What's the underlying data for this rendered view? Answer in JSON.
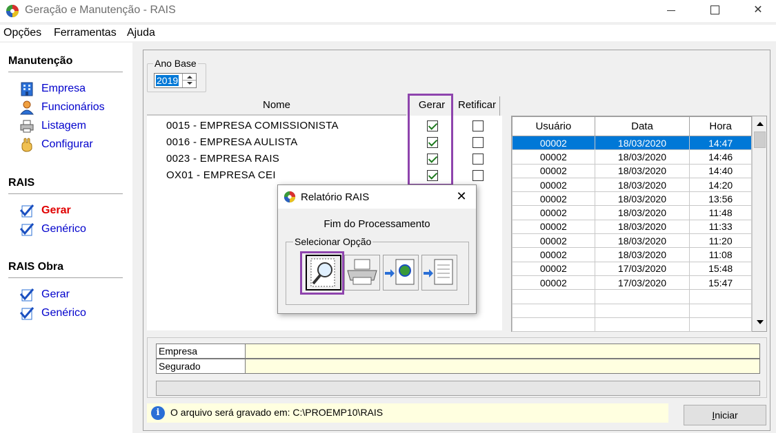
{
  "window": {
    "title": "Geração e Manutenção - RAIS",
    "min": "—",
    "max": "☐",
    "close": "✕"
  },
  "menu": [
    "Opções",
    "Ferramentas",
    "Ajuda"
  ],
  "sidebar": {
    "sections": [
      {
        "title": "Manutenção",
        "items": [
          {
            "label": "Empresa",
            "icon": "building-icon"
          },
          {
            "label": "Funcionários",
            "icon": "person-icon"
          },
          {
            "label": "Listagem",
            "icon": "printer-icon"
          },
          {
            "label": "Configurar",
            "icon": "hand-icon"
          }
        ]
      },
      {
        "title": "RAIS",
        "items": [
          {
            "label": "Gerar",
            "icon": "check-doc-icon",
            "active": true
          },
          {
            "label": "Genérico",
            "icon": "check-doc-icon"
          }
        ]
      },
      {
        "title": "RAIS Obra",
        "items": [
          {
            "label": "Gerar",
            "icon": "check-doc-icon"
          },
          {
            "label": "Genérico",
            "icon": "check-doc-icon"
          }
        ]
      }
    ]
  },
  "ano_base": {
    "label": "Ano Base",
    "value": "2019"
  },
  "company_table": {
    "headers": {
      "nome": "Nome",
      "gerar": "Gerar",
      "retificar": "Retificar"
    },
    "rows": [
      {
        "nome": "0015 - EMPRESA COMISSIONISTA",
        "gerar": true,
        "retificar": false
      },
      {
        "nome": "0016 - EMPRESA AULISTA",
        "gerar": true,
        "retificar": false
      },
      {
        "nome": "0023 - EMPRESA RAIS",
        "gerar": true,
        "retificar": false
      },
      {
        "nome": "OX01 - EMPRESA CEI",
        "gerar": true,
        "retificar": false
      }
    ]
  },
  "history_table": {
    "headers": [
      "Usuário",
      "Data",
      "Hora"
    ],
    "rows": [
      [
        "00002",
        "18/03/2020",
        "14:47"
      ],
      [
        "00002",
        "18/03/2020",
        "14:46"
      ],
      [
        "00002",
        "18/03/2020",
        "14:40"
      ],
      [
        "00002",
        "18/03/2020",
        "14:20"
      ],
      [
        "00002",
        "18/03/2020",
        "13:56"
      ],
      [
        "00002",
        "18/03/2020",
        "11:48"
      ],
      [
        "00002",
        "18/03/2020",
        "11:33"
      ],
      [
        "00002",
        "18/03/2020",
        "11:20"
      ],
      [
        "00002",
        "18/03/2020",
        "11:08"
      ],
      [
        "00002",
        "17/03/2020",
        "15:48"
      ],
      [
        "00002",
        "17/03/2020",
        "15:47"
      ]
    ]
  },
  "fields": {
    "empresa_label": "Empresa",
    "segurado_label": "Segurado"
  },
  "status": {
    "info": "i",
    "text": "O arquivo será gravado em: C:\\PROEMP10\\RAIS"
  },
  "button_iniciar": {
    "first": "I",
    "rest": "niciar"
  },
  "dialog": {
    "title": "Relatório RAIS",
    "close": "✕",
    "message": "Fim do Processamento",
    "group_label": "Selecionar Opção",
    "options": [
      "magnifier-doc-icon",
      "printer-icon",
      "globe-export-icon",
      "doc-export-icon"
    ]
  },
  "colors": {
    "highlight": "#8e44ad",
    "selection": "#0078d7",
    "field_bg": "#ffffe0",
    "active_nav": "#e00000",
    "nav": "#0000cc"
  }
}
